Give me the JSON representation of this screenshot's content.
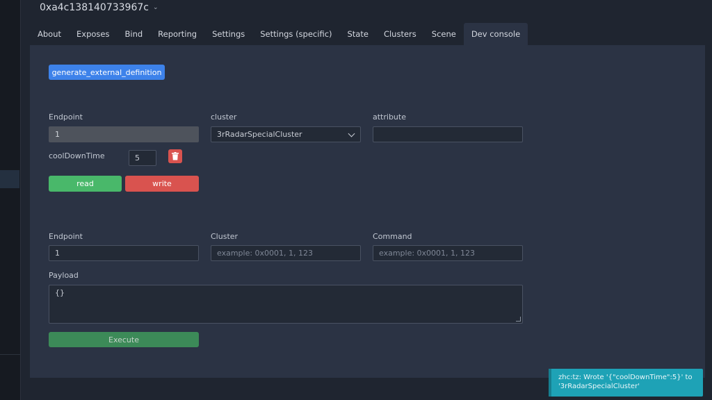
{
  "device": {
    "title": "0xa4c138140733967c"
  },
  "tabs": [
    "About",
    "Exposes",
    "Bind",
    "Reporting",
    "Settings",
    "Settings (specific)",
    "State",
    "Clusters",
    "Scene",
    "Dev console"
  ],
  "active_tab": "Dev console",
  "generate_button": "generate_external_definition",
  "attr_section": {
    "endpoint_label": "Endpoint",
    "endpoint_value": "1",
    "cluster_label": "cluster",
    "cluster_value": "3rRadarSpecialCluster",
    "attribute_label": "attribute",
    "attribute_value": "",
    "attr_name": "coolDownTime",
    "attr_value": "5",
    "read_label": "read",
    "write_label": "write"
  },
  "cmd_section": {
    "endpoint_label": "Endpoint",
    "endpoint_value": "1",
    "cluster_label": "Cluster",
    "cluster_placeholder": "example: 0x0001, 1, 123",
    "command_label": "Command",
    "command_placeholder": "example: 0x0001, 1, 123",
    "payload_label": "Payload",
    "payload_value": "{}",
    "execute_label": "Execute"
  },
  "toast": {
    "line1": "zhc:tz: Wrote '{\"coolDownTime\":5}' to",
    "line2": "'3rRadarSpecialCluster'"
  }
}
